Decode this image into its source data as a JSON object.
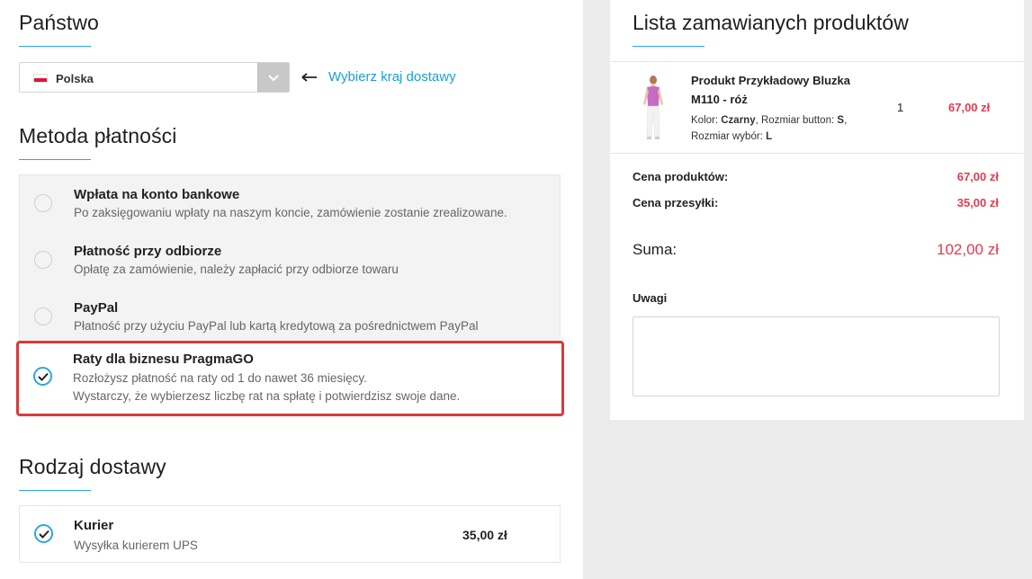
{
  "country": {
    "title": "Państwo",
    "selected": "Polska",
    "hint": "Wybierz kraj dostawy"
  },
  "payment": {
    "title": "Metoda płatności",
    "options": [
      {
        "title": "Wpłata na konto bankowe",
        "desc": "Po zaksięgowaniu wpłaty na naszym koncie, zamówienie zostanie zrealizowane.",
        "selected": false
      },
      {
        "title": "Płatność przy odbiorze",
        "desc": "Opłatę za zamówienie, należy zapłacić przy odbiorze towaru",
        "selected": false
      },
      {
        "title": "PayPal",
        "desc": "Płatność przy użyciu PayPal lub kartą kredytową za pośrednictwem PayPal",
        "selected": false
      },
      {
        "title": "Raty dla biznesu PragmaGO",
        "desc": "Rozłożysz płatność na raty od 1 do nawet 36 miesięcy.",
        "desc2": "Wystarczy, że wybierzesz liczbę rat na spłatę i potwierdzisz swoje dane.",
        "selected": true
      }
    ]
  },
  "shipping": {
    "title": "Rodzaj dostawy",
    "option": {
      "title": "Kurier",
      "desc": "Wysyłka kurierem UPS",
      "price": "35,00 zł",
      "selected": true
    }
  },
  "order": {
    "title": "Lista zamawianych produktów",
    "product": {
      "name_line1": "Produkt Przykładowy Bluzka",
      "name_line2": "M110 - róż",
      "attr_color_label": "Kolor:",
      "attr_color_value": "Czarny",
      "attr_size_button_label": "Rozmiar button:",
      "attr_size_button_value": "S",
      "attr_size_choice_label": "Rozmiar wybór:",
      "attr_size_choice_value": "L",
      "qty": "1",
      "price": "67,00 zł"
    },
    "products_price_label": "Cena produktów:",
    "products_price": "67,00 zł",
    "shipping_price_label": "Cena przesyłki:",
    "shipping_price": "35,00 zł",
    "total_label": "Suma:",
    "total": "102,00 zł",
    "notes_label": "Uwagi",
    "notes_value": ""
  },
  "colors": {
    "accent": "#29a8e0",
    "price": "#e8384f",
    "highlight": "#d93a3a"
  }
}
